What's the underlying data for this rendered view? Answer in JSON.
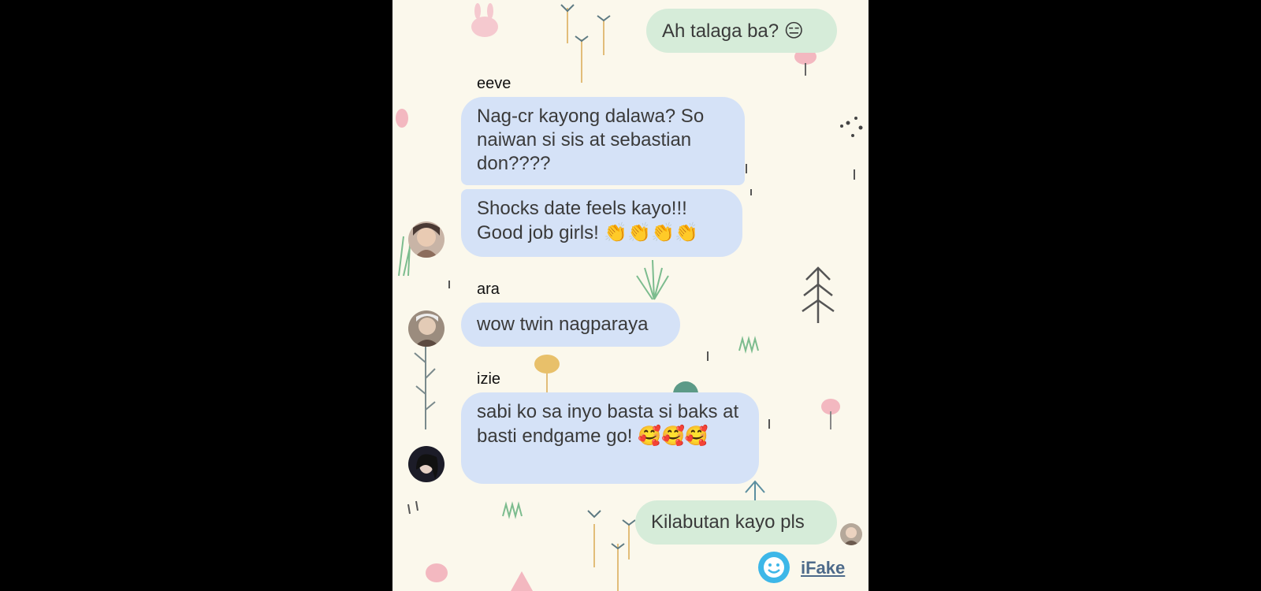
{
  "messages": [
    {
      "id": "m1",
      "direction": "out",
      "text": "Ah talaga ba?",
      "emoji": "😑"
    },
    {
      "id": "m2",
      "direction": "in",
      "sender": "eeve",
      "text": "Nag-cr kayong dalawa? So naiwan si sis at sebastian don????"
    },
    {
      "id": "m3",
      "direction": "in",
      "sender": "eeve",
      "text": "Shocks date feels kayo!!! Good job girls!",
      "emoji": "👏👏👏👏"
    },
    {
      "id": "m4",
      "direction": "in",
      "sender": "ara",
      "text": "wow twin nagparaya"
    },
    {
      "id": "m5",
      "direction": "in",
      "sender": "izie",
      "text": "sabi ko sa inyo basta si baks at basti endgame go!",
      "emoji": "🥰🥰🥰"
    },
    {
      "id": "m6",
      "direction": "out",
      "text": "Kilabutan kayo pls"
    }
  ],
  "senders": {
    "eeve": "eeve",
    "ara": "ara",
    "izie": "izie"
  },
  "brand": {
    "label": "iFake",
    "icon": "smiley-face-icon"
  },
  "colors": {
    "background": "#fbf8ec",
    "incoming_bubble": "#d5e2f7",
    "outgoing_bubble": "#d6ecd9",
    "brand": "#3db7e8"
  }
}
